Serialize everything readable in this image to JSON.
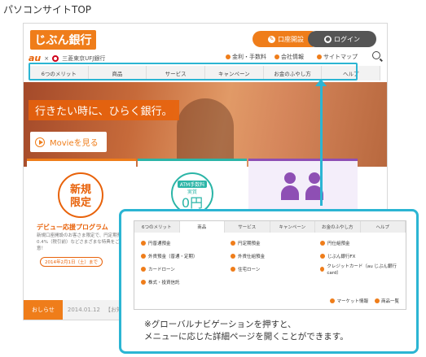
{
  "caption_title": "パソコンサイトTOP",
  "site": {
    "logo_text": "じぶん銀行",
    "partner_au": "au",
    "partner_x": "×",
    "partner_bank": "三菱東京UFJ銀行",
    "open_account_label": "口座開設",
    "login_label": "ログイン",
    "util_links": [
      "金利・手数料",
      "会社情報",
      "サイトマップ"
    ],
    "gnav": [
      "6つのメリット",
      "商品",
      "サービス",
      "キャンペーン",
      "お金のふやし方",
      "ヘルプ"
    ],
    "hero_tagline": "行きたい時に、ひらく銀行。",
    "hero_movie": "Movieを見る",
    "panel1": {
      "badge_line1": "新規",
      "badge_line2": "限定",
      "link": "デビュー応援プログラム",
      "text": "新規口座開設のお客さま限定で、円定期預金0.4%（税引前）などさまざまな特典をご用意！",
      "date": "2014年2月1日（土）まで"
    },
    "panel2": {
      "atm_line1": "ATM手数料",
      "atm_line2": "実質",
      "zero": "0円"
    },
    "news_tag": "おしらせ",
    "news_date": "2014.01.12",
    "news_text": "【お知らせ】"
  },
  "popup": {
    "nav": [
      "6つのメリット",
      "商品",
      "サービス",
      "キャンペーン",
      "お金のふやし方",
      "ヘルプ"
    ],
    "items": [
      "円普通預金",
      "円定期預金",
      "円仕組預金",
      "外貨預金（普通・定期）",
      "外貨仕組預金",
      "じぶん銀行FX",
      "カードローン",
      "住宅ローン",
      "クレジットカード（au じぶん銀行card）",
      "株式・投資信託"
    ],
    "footer": [
      "マーケット情報",
      "商品一覧"
    ],
    "note_line1": "※グローバルナビゲーションを押すと、",
    "note_line2": "メニューに応じた詳細ページを開くことができます。"
  },
  "colors": {
    "accent": "#ef7d1a",
    "highlight": "#2bb5d3",
    "teal": "#2bb5a7",
    "purple": "#8e4fb4"
  }
}
